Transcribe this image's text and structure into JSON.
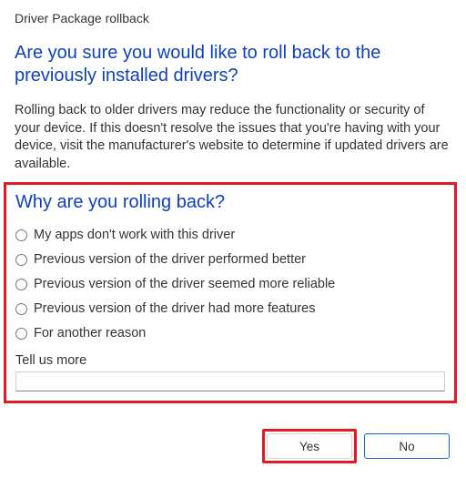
{
  "window": {
    "title": "Driver Package rollback"
  },
  "heading": "Are you sure you would like to roll back to the previously installed drivers?",
  "body": "Rolling back to older drivers may reduce the functionality or security of your device. If this doesn't resolve the issues that you're having with your device, visit the manufacturer's website to determine if updated drivers are available.",
  "subheading": "Why are you rolling back?",
  "reasons": [
    "My apps don't work with this driver",
    "Previous version of the driver performed better",
    "Previous version of the driver seemed more reliable",
    "Previous version of the driver had more features",
    "For another reason"
  ],
  "tell_more": {
    "label": "Tell us more",
    "value": ""
  },
  "buttons": {
    "yes": "Yes",
    "no": "No"
  },
  "highlight_color": "#e01b24",
  "accent_color": "#0f3fbf"
}
